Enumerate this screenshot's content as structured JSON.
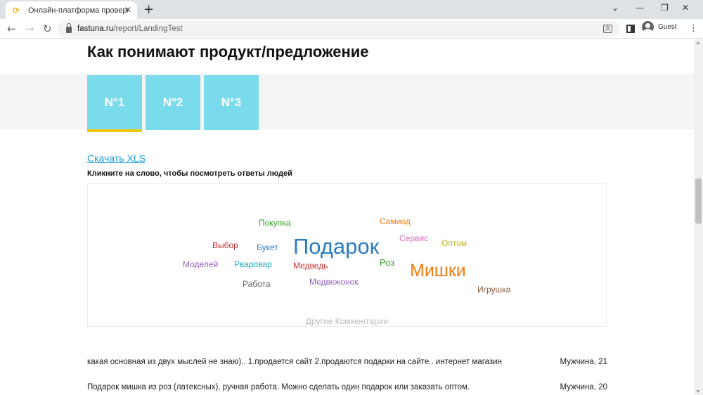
{
  "browser": {
    "tab_title": "Онлайн-платформа проверки и",
    "favicon_glyph": "⟳",
    "url_domain": "fastuna.ru",
    "url_path": "/report/LandingTest",
    "profile_name": "Guest"
  },
  "page": {
    "title": "Как понимают продукт/предложение",
    "segments": [
      {
        "label": "N°1"
      },
      {
        "label": "N°2"
      },
      {
        "label": "N°3"
      }
    ],
    "active_segment_color": "#f2c500",
    "segment_color": "#7adbec",
    "download_label": "Скачать XLS",
    "hint": "Кликните на слово, чтобы посмотреть ответы людей",
    "other_comments_label": "Другие Комментарии"
  },
  "word_cloud": {
    "words": [
      {
        "text": "Подарок",
        "color": "#2b7bbf",
        "weight": 5
      },
      {
        "text": "Мишки",
        "color": "#f57c13",
        "weight": 4
      },
      {
        "text": "Покупка",
        "color": "#3a9a2e",
        "weight": 1
      },
      {
        "text": "Самиод",
        "color": "#f57c13",
        "weight": 1
      },
      {
        "text": "Сервис",
        "color": "#d868b8",
        "weight": 1
      },
      {
        "text": "Оптом",
        "color": "#c2b224",
        "weight": 1
      },
      {
        "text": "Выбор",
        "color": "#c62f2f",
        "weight": 1
      },
      {
        "text": "Букет",
        "color": "#2b7bbf",
        "weight": 1
      },
      {
        "text": "Моделей",
        "color": "#9560c0",
        "weight": 1
      },
      {
        "text": "Рварлвар",
        "color": "#22aab8",
        "weight": 1
      },
      {
        "text": "Медведь",
        "color": "#c62f2f",
        "weight": 1
      },
      {
        "text": "Роз",
        "color": "#3a9a2e",
        "weight": 1
      },
      {
        "text": "Работа",
        "color": "#666666",
        "weight": 1
      },
      {
        "text": "Медвежонок",
        "color": "#9560c0",
        "weight": 1
      },
      {
        "text": "Игрушка",
        "color": "#8c5a3c",
        "weight": 1
      }
    ]
  },
  "responses": [
    {
      "text": "какая основная из двух мыслей не знаю).. 1.продается сайт 2.продаются подарки на сайте.. интернет магазин",
      "who": "Мужчина, 21"
    },
    {
      "text": "Подарок мишка из роз (латексных), ручная работа. Можно сделать один подарок или заказать оптом.",
      "who": "Мужчина, 20"
    }
  ]
}
